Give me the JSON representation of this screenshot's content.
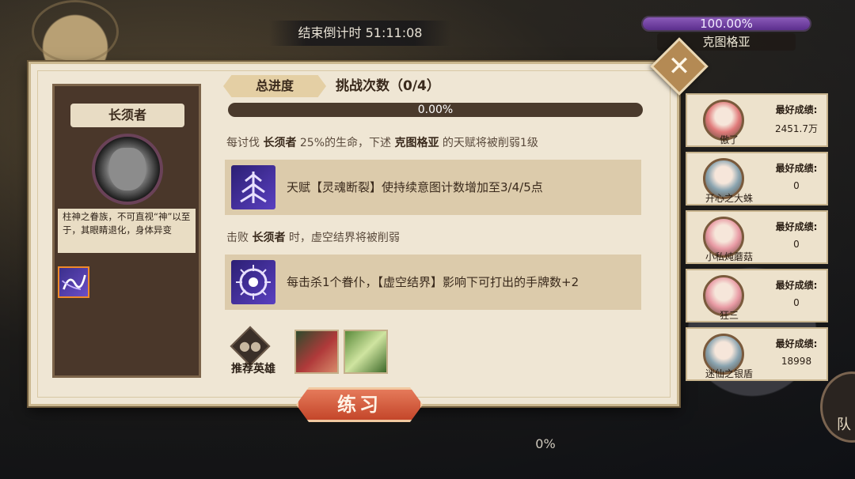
{
  "countdown": {
    "text": "结束倒计时 51:11:08"
  },
  "boss_hp": {
    "percent_text": "100.00%",
    "fill": 1.0,
    "boss_name": "克图格亚"
  },
  "close_button": {
    "label": "✕"
  },
  "boss_card": {
    "name": "长须者",
    "description": "柱神之眷族，不可直视“神”以至于，其眼睛退化，身体异变"
  },
  "progress": {
    "tab_label": "总进度",
    "challenge_count": "挑战次数（0/4）",
    "percent_text": "0.00%",
    "fill": 0.0
  },
  "rule1": {
    "prefix": "每讨伐 ",
    "boss": "长须者",
    "middle": " 25%的生命，下述 ",
    "target": "克图格亚",
    "suffix": " 的天赋将被削弱1级"
  },
  "effect1": {
    "text": "天赋【灵魂断裂】使持续意图计数增加至3/4/5点"
  },
  "rule2": {
    "prefix": "击败 ",
    "boss": "长须者",
    "suffix": " 时，虚空结界将被削弱"
  },
  "effect2": {
    "text": "每击杀1个眷仆，【虚空结界】影响下可打出的手牌数+2"
  },
  "recommend": {
    "label": "推荐英雄"
  },
  "practice_button": {
    "label": "练习"
  },
  "ranking": [
    {
      "name": "傲了",
      "label": "最好成绩:",
      "score": "2451.7万",
      "color": "#e07a7a"
    },
    {
      "name": "开心之大蛛",
      "label": "最好成绩:",
      "score": "0",
      "color": "#8aa4b0"
    },
    {
      "name": "小私炖蘑菇",
      "label": "最好成绩:",
      "score": "0",
      "color": "#e89aa4"
    },
    {
      "name": "狂三",
      "label": "最好成绩:",
      "score": "0",
      "color": "#e89aa4"
    },
    {
      "name": "迷仙之银盾",
      "label": "最好成绩:",
      "score": "18998",
      "color": "#8aa4b0"
    }
  ],
  "bottom_percent": "0%",
  "side_button": {
    "label": "队"
  }
}
